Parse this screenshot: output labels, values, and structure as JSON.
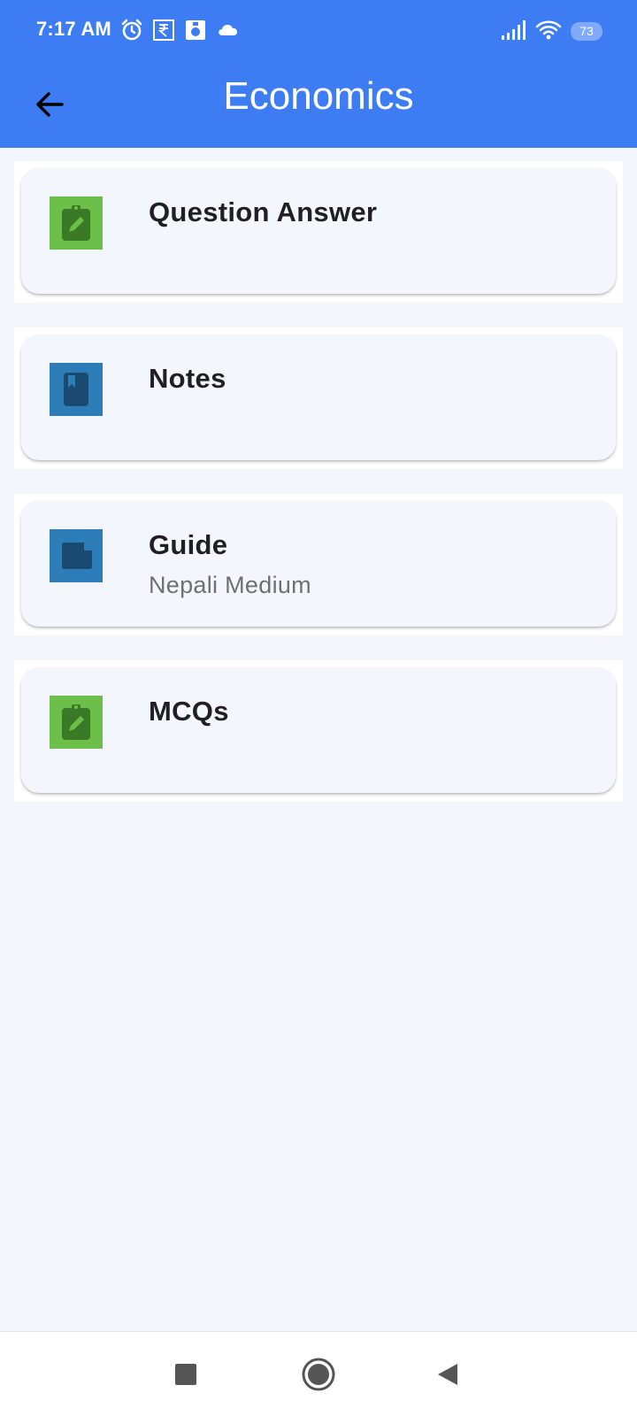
{
  "status_bar": {
    "time": "7:17 AM",
    "battery": "73",
    "icons": [
      "alarm-icon",
      "rupee-icon",
      "app-icon",
      "cloud-icon",
      "signal-icon",
      "wifi-icon",
      "battery-icon"
    ]
  },
  "app_bar": {
    "title": "Economics",
    "back_icon": "arrow-left-icon"
  },
  "items": [
    {
      "label": "Question Answer",
      "subtitle": "",
      "icon": "clipboard-edit-icon",
      "icon_bg": "#6cc04a",
      "icon_fg": "#3a7a26"
    },
    {
      "label": "Notes",
      "subtitle": "",
      "icon": "bookmark-book-icon",
      "icon_bg": "#2d7db8",
      "icon_fg": "#1a4a72"
    },
    {
      "label": "Guide",
      "subtitle": "Nepali Medium",
      "icon": "document-icon",
      "icon_bg": "#2d7db8",
      "icon_fg": "#1a4a72"
    },
    {
      "label": "MCQs",
      "subtitle": "",
      "icon": "clipboard-edit-icon",
      "icon_bg": "#6cc04a",
      "icon_fg": "#3a7a26"
    }
  ],
  "nav_bar": {
    "buttons": [
      "recents-button",
      "home-button",
      "back-button"
    ]
  },
  "colors": {
    "app_bar": "#3d7cf3",
    "background": "#f5f5fd",
    "card": "#f4f6fd"
  }
}
